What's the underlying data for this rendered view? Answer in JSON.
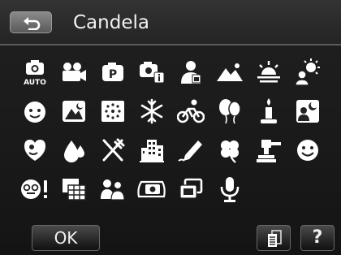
{
  "header": {
    "title": "Candela",
    "back_icon": "back-arrow-icon"
  },
  "scene_modes": [
    {
      "icon": "auto-camera-icon",
      "label": "AUTO"
    },
    {
      "icon": "movie-camera-icon"
    },
    {
      "icon": "program-p-icon",
      "label": "P"
    },
    {
      "icon": "camera-info-icon"
    },
    {
      "icon": "portrait-icon"
    },
    {
      "icon": "landscape-icon"
    },
    {
      "icon": "sunset-icon"
    },
    {
      "icon": "backlight-icon"
    },
    {
      "icon": "kids-face-icon"
    },
    {
      "icon": "night-scene-icon"
    },
    {
      "icon": "fireworks-icon"
    },
    {
      "icon": "snow-icon"
    },
    {
      "icon": "sports-bicycle-icon"
    },
    {
      "icon": "party-balloon-icon"
    },
    {
      "icon": "candlelight-icon"
    },
    {
      "icon": "night-portrait-icon"
    },
    {
      "icon": "soft-skin-icon"
    },
    {
      "icon": "water-drop-icon"
    },
    {
      "icon": "food-icon"
    },
    {
      "icon": "building-icon"
    },
    {
      "icon": "text-pencil-icon"
    },
    {
      "icon": "leaf-clover-icon"
    },
    {
      "icon": "auction-icon"
    },
    {
      "icon": "smile-capture-icon"
    },
    {
      "icon": "blink-detection-icon"
    },
    {
      "icon": "collage-frame-icon"
    },
    {
      "icon": "pre-composition-icon"
    },
    {
      "icon": "coupon-camera-icon"
    },
    {
      "icon": "multi-frame-icon"
    },
    {
      "icon": "voice-recording-icon"
    }
  ],
  "footer": {
    "ok_label": "OK",
    "help_label": "?",
    "display_icon": "display-mode-icon"
  },
  "colors": {
    "background": "#191919",
    "icon": "#ffffff",
    "title_text": "#f2f2f2"
  }
}
